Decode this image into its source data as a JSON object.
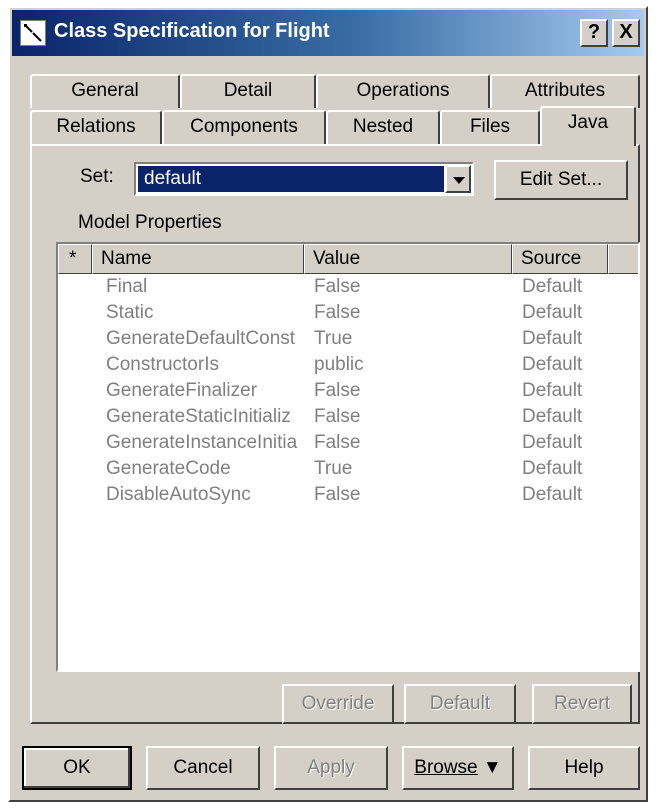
{
  "window": {
    "title": "Class Specification for Flight",
    "help_button": "?",
    "close_button": "X"
  },
  "tabs": {
    "row1": [
      "General",
      "Detail",
      "Operations",
      "Attributes"
    ],
    "row2": [
      "Relations",
      "Components",
      "Nested",
      "Files",
      "Java"
    ],
    "active": "Java"
  },
  "set": {
    "label": "Set:",
    "value": "default",
    "edit_button": "Edit Set..."
  },
  "model_properties": {
    "label": "Model Properties",
    "columns": [
      "*",
      "Name",
      "Value",
      "Source"
    ],
    "rows": [
      {
        "name": "Final",
        "value": "False",
        "source": "Default"
      },
      {
        "name": "Static",
        "value": "False",
        "source": "Default"
      },
      {
        "name": "GenerateDefaultConst",
        "value": "True",
        "source": "Default"
      },
      {
        "name": "ConstructorIs",
        "value": "public",
        "source": "Default"
      },
      {
        "name": "GenerateFinalizer",
        "value": "False",
        "source": "Default"
      },
      {
        "name": "GenerateStaticInitializ",
        "value": "False",
        "source": "Default"
      },
      {
        "name": "GenerateInstanceInitia",
        "value": "False",
        "source": "Default"
      },
      {
        "name": "GenerateCode",
        "value": "True",
        "source": "Default"
      },
      {
        "name": "DisableAutoSync",
        "value": "False",
        "source": "Default"
      }
    ]
  },
  "property_buttons": {
    "override": "Override",
    "default": "Default",
    "revert": "Revert"
  },
  "footer": {
    "ok": "OK",
    "cancel": "Cancel",
    "apply": "Apply",
    "browse": "Browse",
    "help": "Help"
  },
  "colors": {
    "face": "#d4d0c8",
    "title_start": "#0a246a",
    "title_end": "#a6caf0",
    "selection": "#0a246a",
    "disabled_text": "#808080"
  }
}
